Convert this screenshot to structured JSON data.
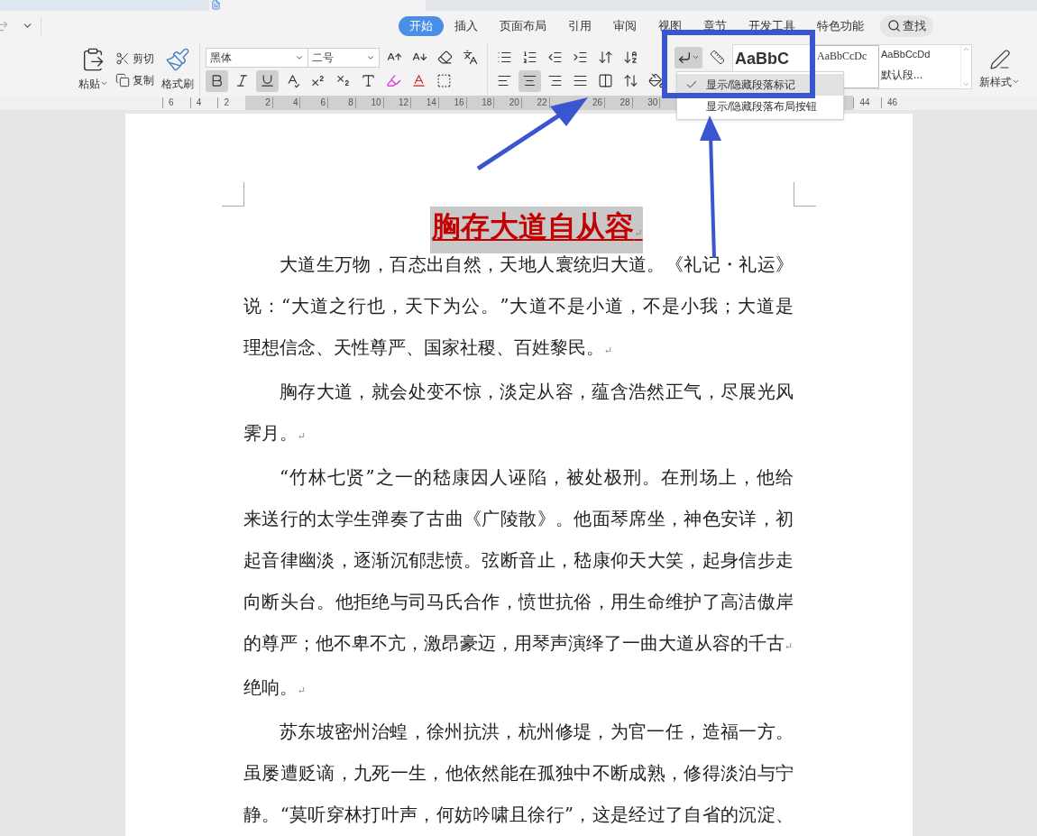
{
  "ribbon_tabs": [
    {
      "label": "开始",
      "selected": true
    },
    {
      "label": "插入",
      "selected": false
    },
    {
      "label": "页面布局",
      "selected": false
    },
    {
      "label": "引用",
      "selected": false
    },
    {
      "label": "审阅",
      "selected": false
    },
    {
      "label": "视图",
      "selected": false
    },
    {
      "label": "章节",
      "selected": false
    },
    {
      "label": "开发工具",
      "selected": false
    },
    {
      "label": "特色功能",
      "selected": false
    }
  ],
  "search": {
    "label": "查找"
  },
  "clipboard": {
    "paste": "粘贴",
    "cut": "剪切",
    "copy": "复制",
    "format_painter": "格式刷"
  },
  "font": {
    "family": "黑体",
    "size": "二号"
  },
  "font_tools_top": [
    {
      "kind": "grow",
      "pressed": false
    },
    {
      "kind": "shrink",
      "pressed": false
    },
    {
      "kind": "clear",
      "pressed": false
    },
    {
      "kind": "pinyin",
      "pressed": false
    }
  ],
  "font_tools_bottom": [
    {
      "kind": "bold",
      "pressed": true
    },
    {
      "kind": "italic",
      "pressed": false
    },
    {
      "kind": "underline",
      "pressed": true
    },
    {
      "kind": "emphasis",
      "pressed": false
    },
    {
      "kind": "superscript",
      "pressed": false
    },
    {
      "kind": "subscript",
      "pressed": false
    },
    {
      "kind": "text-effect",
      "pressed": false
    },
    {
      "kind": "highlight",
      "pressed": false
    },
    {
      "kind": "font-color",
      "pressed": false
    },
    {
      "kind": "char-border",
      "pressed": false
    }
  ],
  "paragraph_tools_top": [
    {
      "kind": "bullets",
      "pressed": false
    },
    {
      "kind": "numbering",
      "pressed": false
    },
    {
      "kind": "outdent",
      "pressed": false
    },
    {
      "kind": "indent",
      "pressed": false
    },
    {
      "kind": "direction",
      "pressed": false
    },
    {
      "kind": "sort",
      "pressed": false
    }
  ],
  "paragraph_tools_bottom": [
    {
      "kind": "align-left",
      "pressed": false
    },
    {
      "kind": "align-center",
      "pressed": true
    },
    {
      "kind": "align-right",
      "pressed": false
    },
    {
      "kind": "justify",
      "pressed": false
    },
    {
      "kind": "distribute",
      "pressed": false
    },
    {
      "kind": "line-spacing",
      "pressed": false
    },
    {
      "kind": "shading",
      "pressed": false
    }
  ],
  "marks_button": {
    "pressed": true
  },
  "styles": [
    {
      "sample": "AaBbC",
      "kind": "heading"
    },
    {
      "sample": "AaBbCcDc",
      "kind": "serif"
    },
    {
      "sample": "AaBbCcDd",
      "label": "默认段...",
      "kind": "normal"
    }
  ],
  "new_style": {
    "label": "新样式"
  },
  "ruler": {
    "left_labels": [
      "6",
      "4",
      "2"
    ],
    "right_labels": [
      "2",
      "4",
      "6",
      "8",
      "10",
      "12",
      "14",
      "16",
      "18",
      "20",
      "22"
    ],
    "labels_after_arrow": [
      "26",
      "28",
      "30"
    ],
    "far_labels": [
      "44",
      "46"
    ]
  },
  "menu": {
    "items": [
      {
        "label": "显示/隐藏段落标记",
        "checked": true
      },
      {
        "label": "显示/隐藏段落布局按钮",
        "checked": false
      }
    ]
  },
  "document": {
    "title": "胸存大道自从容",
    "mark": "↵",
    "paragraphs": [
      {
        "lines": [
          "大道生万物，百态出自然，天地人寰统归大道。《礼记・礼运》",
          "说：“大道之行也，天下为公。”大道不是小道，不是小我；大道是",
          "理想信念、天性尊严、国家社稷、百姓黎民。"
        ],
        "marks": [
          false,
          false,
          true
        ]
      },
      {
        "lines": [
          "胸存大道，就会处变不惊，淡定从容，蕴含浩然正气，尽展光风",
          "霁月。"
        ],
        "marks": [
          false,
          true
        ]
      },
      {
        "lines": [
          "“竹林七贤”之一的嵇康因人诬陷，被处极刑。在刑场上，他给",
          "来送行的太学生弹奏了古曲《广陵散》。他面琴席坐，神色安详，初",
          "起音律幽淡，逐渐沉郁悲愤。弦断音止，嵇康仰天大笑，起身信步走",
          "向断头台。他拒绝与司马氏合作，愤世抗俗，用生命维护了高洁傲岸",
          "的尊严；他不卑不亢，激昂豪迈，用琴声演绎了一曲大道从容的千古",
          "绝响。"
        ],
        "marks": [
          false,
          false,
          false,
          false,
          true,
          true
        ]
      },
      {
        "lines": [
          "苏东坡密州治蝗，徐州抗洪，杭州修堤，为官一任，造福一方。",
          "虽屡遭贬谪，九死一生，他依然能在孤独中不断成熟，修得淡泊与宁",
          "静。“莫听穿林打叶声，何妨吟啸且徐行”，这是经过了自省的沉淀、"
        ],
        "marks": [
          false,
          false,
          false
        ]
      }
    ]
  }
}
